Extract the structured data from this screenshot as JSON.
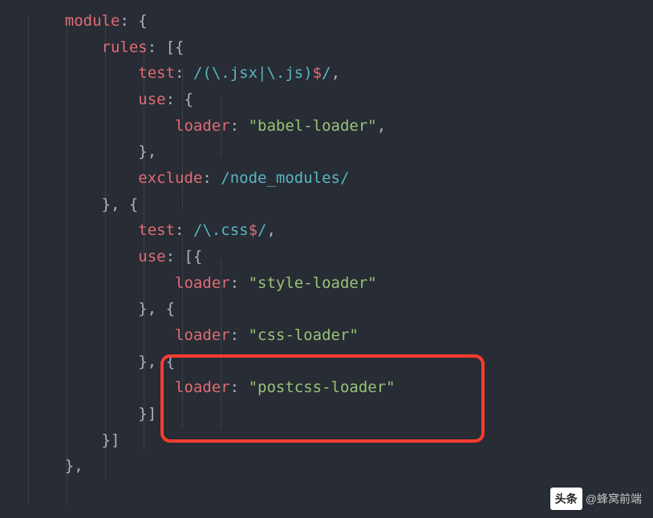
{
  "code": {
    "l1": {
      "key": "module",
      "punct": ": {"
    },
    "l2": {
      "key": "rules",
      "punct": ": [{"
    },
    "l3": {
      "key": "test",
      "punct": ": ",
      "regex": "/(\\.jsx|\\.js)",
      "end": "$",
      "close": "/,",
      "comma": ","
    },
    "l4": {
      "key": "use",
      "punct": ": {"
    },
    "l5": {
      "key": "loader",
      "punct": ": ",
      "string": "\"babel-loader\"",
      "comma": ","
    },
    "l6": {
      "punct": "},"
    },
    "l7": {
      "key": "exclude",
      "punct": ": ",
      "regex": "/node_modules/"
    },
    "l8": {
      "punct": "}, {"
    },
    "l9": {
      "key": "test",
      "punct": ": ",
      "regex": "/\\.css",
      "end": "$",
      "close": "/,",
      "comma": ","
    },
    "l10": {
      "key": "use",
      "punct": ": [{"
    },
    "l11": {
      "key": "loader",
      "punct": ": ",
      "string": "\"style-loader\""
    },
    "l12": {
      "punct": "}, {"
    },
    "l13": {
      "key": "loader",
      "punct": ": ",
      "string": "\"css-loader\""
    },
    "l14": {
      "punct": "}, {"
    },
    "l15": {
      "key": "loader",
      "punct": ": ",
      "string": "\"postcss-loader\""
    },
    "l16": {
      "punct": "}]"
    },
    "l17": {
      "punct": "}]"
    },
    "l18": {
      "punct": "},"
    }
  },
  "watermark": {
    "badge": "头条",
    "text": "@蜂窝前端"
  },
  "chart_data": {
    "type": "table",
    "title": "webpack module rules config snippet",
    "module": {
      "rules": [
        {
          "test": "/(\\.jsx|\\.js)$/",
          "use": {
            "loader": "babel-loader"
          },
          "exclude": "/node_modules/"
        },
        {
          "test": "/\\.css$/",
          "use": [
            {
              "loader": "style-loader"
            },
            {
              "loader": "css-loader"
            },
            {
              "loader": "postcss-loader"
            }
          ]
        }
      ]
    },
    "highlighted": [
      "}, {",
      "    loader: \"postcss-loader\"",
      "}]"
    ]
  }
}
